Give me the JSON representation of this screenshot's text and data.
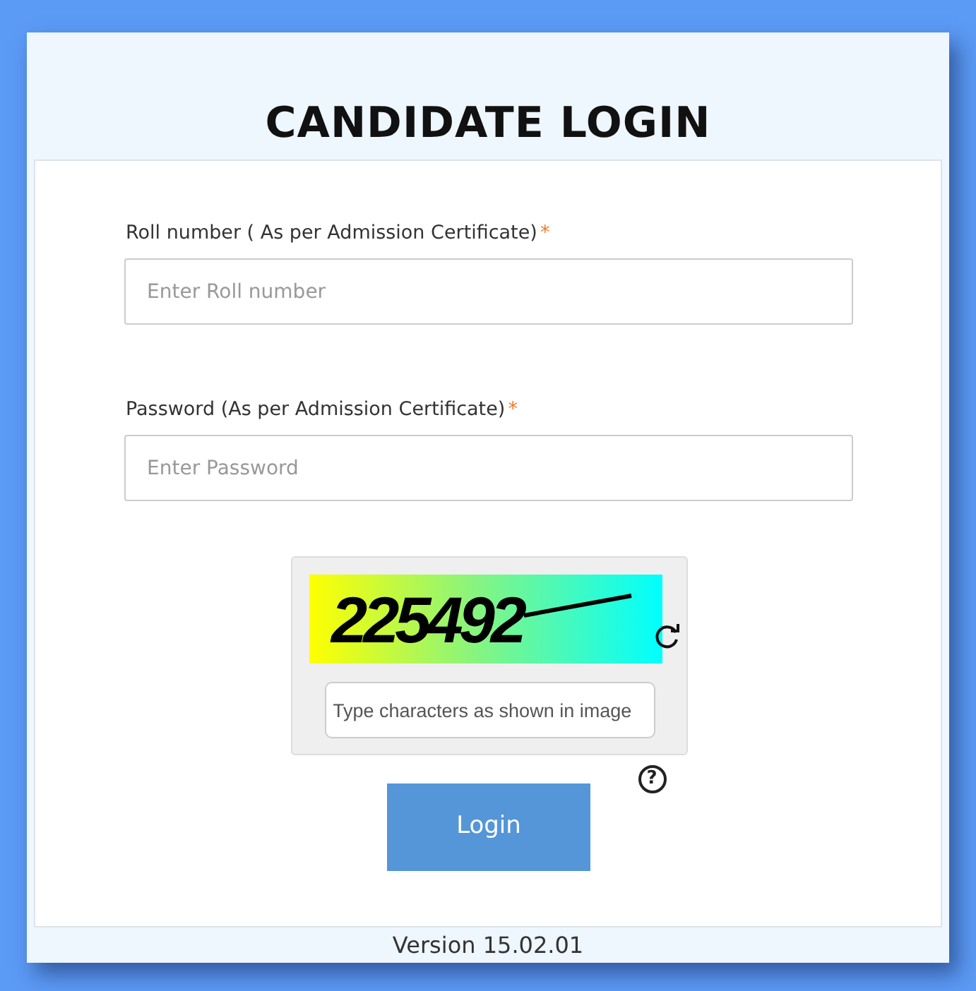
{
  "title": "CANDIDATE LOGIN",
  "fields": [
    {
      "label": "Roll number ( As per Admission Certificate)",
      "required_mark": "*",
      "placeholder": "Enter Roll number"
    },
    {
      "label": "Password (As per Admission Certificate)",
      "required_mark": "*",
      "placeholder": "Enter Password"
    }
  ],
  "captcha": {
    "code": "225492",
    "placeholder": "Type characters as shown in image",
    "help": "?"
  },
  "login_button": "Login",
  "version": "Version 15.02.01"
}
